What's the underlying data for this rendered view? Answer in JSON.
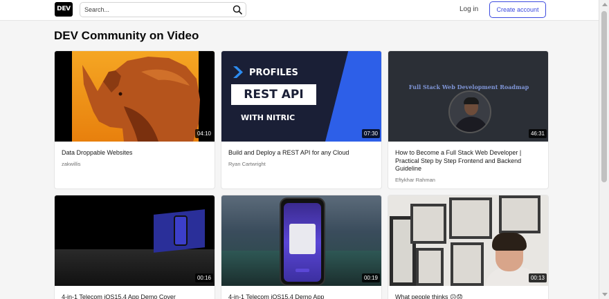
{
  "header": {
    "logo_text": "DEV",
    "search_placeholder": "Search...",
    "login_label": "Log in",
    "create_account_label": "Create account"
  },
  "page": {
    "title": "DEV Community on Video"
  },
  "videos": [
    {
      "title": "Data Droppable Websites",
      "author": "zakwillis",
      "duration": "04:10"
    },
    {
      "title": "Build and Deploy a REST API for any Cloud",
      "author": "Ryan Cartwright",
      "duration": "07:30",
      "thumb_text": {
        "profiles": "PROFILES",
        "rest_api": "REST API",
        "with_nitric": "WITH NITRIC"
      }
    },
    {
      "title": "How to Become a Full Stack Web Developer | Practical Step by Step Frontend and Backend Guideline",
      "author": "Eftykhar Rahman",
      "duration": "46:31",
      "thumb_text": {
        "roadmap": "Full Stack Web Development Roadmap"
      }
    },
    {
      "title": "4-in-1 Telecom iOS15.4 App Demo Cover",
      "author": "",
      "duration": "00:16"
    },
    {
      "title": "4-in-1 Telecom iOS15.4 Demo App",
      "author": "",
      "duration": "00:19"
    },
    {
      "title": "What people thinks 😕😟",
      "author": "",
      "duration": "00:13"
    }
  ],
  "colors": {
    "accent": "#3b49df",
    "background": "#f5f5f5"
  }
}
